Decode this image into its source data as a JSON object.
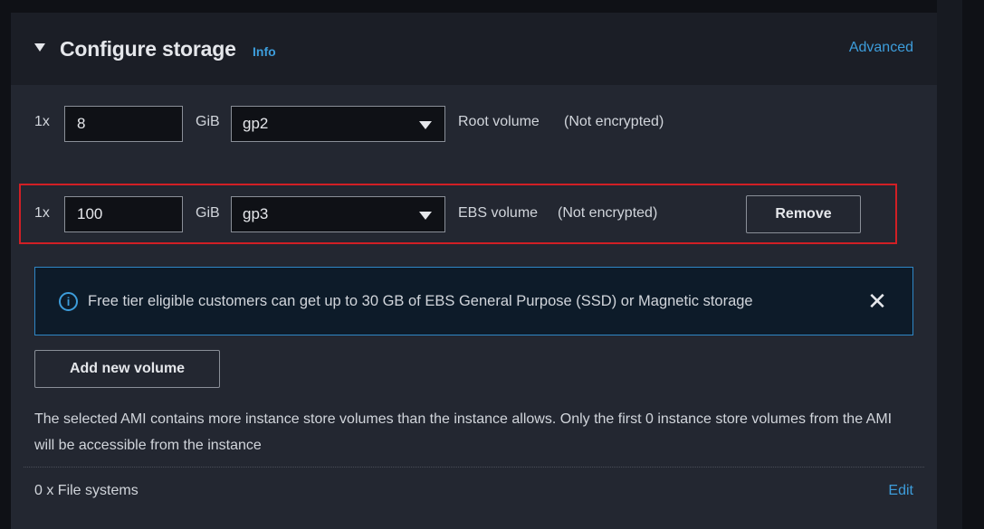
{
  "section": {
    "title": "Configure storage",
    "info_link": "Info",
    "advanced_link": "Advanced"
  },
  "volumes": [
    {
      "count_label": "1x",
      "size": "8",
      "unit": "GiB",
      "type": "gp2",
      "name": "Root volume",
      "encryption": "(Not encrypted)"
    },
    {
      "count_label": "1x",
      "size": "100",
      "unit": "GiB",
      "type": "gp3",
      "name": "EBS volume",
      "encryption": "(Not encrypted)",
      "remove_label": "Remove"
    }
  ],
  "alert": {
    "icon": "info-icon",
    "text": "Free tier eligible customers can get up to 30 GB of EBS General Purpose (SSD) or Magnetic storage",
    "close_icon": "close-icon"
  },
  "add_volume_label": "Add new volume",
  "warning_text": "The selected AMI contains more instance store volumes than the instance allows. Only the first 0 instance store volumes from the AMI will be accessible from the instance",
  "file_systems": {
    "label": "0 x File systems",
    "edit_link": "Edit"
  },
  "colors": {
    "link": "#3d9ddb",
    "highlight": "#d11f25",
    "alert_border": "#2f87c6"
  }
}
